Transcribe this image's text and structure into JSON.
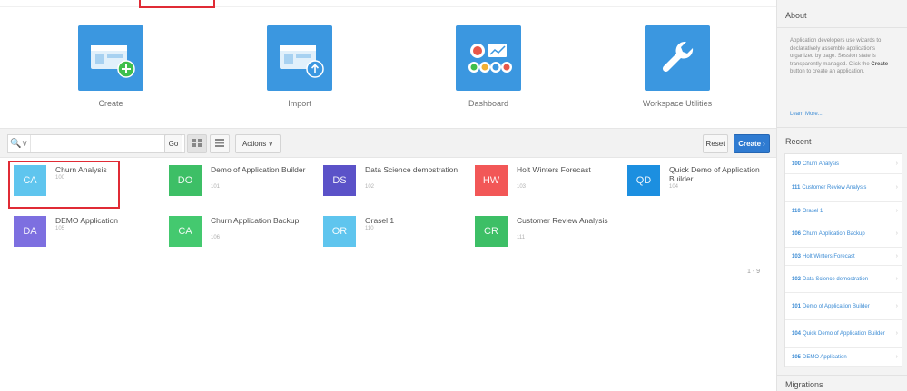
{
  "launch": [
    {
      "label": "Create",
      "icon": "create-app-icon"
    },
    {
      "label": "Import",
      "icon": "import-app-icon"
    },
    {
      "label": "Dashboard",
      "icon": "dashboard-icon"
    },
    {
      "label": "Workspace Utilities",
      "icon": "wrench-icon"
    }
  ],
  "toolbar": {
    "search_icon": "search-icon",
    "search_value": "",
    "go_label": "Go",
    "actions_label": "Actions",
    "reset_label": "Reset",
    "create_label": "Create"
  },
  "apps": [
    {
      "initials": "CA",
      "name": "Churn Analysis",
      "id": "100",
      "color": "#5fc5ee"
    },
    {
      "initials": "DO",
      "name": "Demo of Application Builder",
      "id": "101",
      "color": "#3dbf66"
    },
    {
      "initials": "DS",
      "name": "Data Science demostration",
      "id": "102",
      "color": "#5b52c8"
    },
    {
      "initials": "HW",
      "name": "Holt Winters Forecast",
      "id": "103",
      "color": "#f25757"
    },
    {
      "initials": "QD",
      "name": "Quick Demo of Application Builder",
      "id": "104",
      "color": "#1c8fe0"
    },
    {
      "initials": "DA",
      "name": "DEMO Application",
      "id": "105",
      "color": "#7d6fe0"
    },
    {
      "initials": "CA",
      "name": "Churn Application Backup",
      "id": "106",
      "color": "#44c96f"
    },
    {
      "initials": "OR",
      "name": "Orasel 1",
      "id": "110",
      "color": "#5fc5ee"
    },
    {
      "initials": "CR",
      "name": "Customer Review Analysis",
      "id": "111",
      "color": "#3dbf66"
    }
  ],
  "pager": "1 - 9",
  "sidebar": {
    "about_title": "About",
    "about_pre": "Application developers use wizards to declaratively assemble applications organized by page. Session state is transparently managed. Click the ",
    "about_bold": "Create",
    "about_post": " button to create an application.",
    "learn_more": "Learn More...",
    "recent_title": "Recent",
    "recent": [
      {
        "num": "100",
        "name": "Churn Analysis"
      },
      {
        "num": "111",
        "name": "Customer Review Analysis"
      },
      {
        "num": "110",
        "name": "Orasel 1"
      },
      {
        "num": "106",
        "name": "Churn Application Backup"
      },
      {
        "num": "103",
        "name": "Holt Winters Forecast"
      },
      {
        "num": "102",
        "name": "Data Science demostration"
      },
      {
        "num": "101",
        "name": "Demo of Application Builder"
      },
      {
        "num": "104",
        "name": "Quick Demo of Application Builder"
      },
      {
        "num": "105",
        "name": "DEMO Application"
      }
    ],
    "migrations_title": "Migrations"
  }
}
